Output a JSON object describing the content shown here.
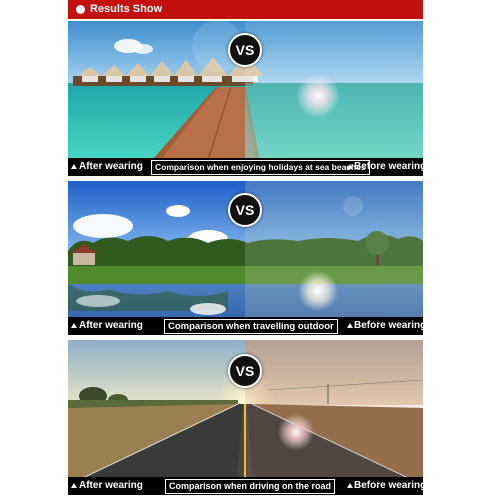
{
  "header": {
    "title": "Results Show"
  },
  "panels": [
    {
      "vs": "VS",
      "left_label": "After wearing",
      "caption": "Comparison when enjoying holidays at sea beaches",
      "right_label": "Before wearing"
    },
    {
      "vs": "VS",
      "left_label": "After wearing",
      "caption": "Comparison when travelling outdoor",
      "right_label": "Before wearing"
    },
    {
      "vs": "VS",
      "left_label": "After wearing",
      "caption": "Comparison when driving on the road",
      "right_label": "Before wearing"
    }
  ],
  "colors": {
    "header": "#c40f0f",
    "caption_bar": "#000000",
    "text": "#ffffff"
  },
  "icons": [
    "header-bullet-icon",
    "up-triangle-icon"
  ]
}
